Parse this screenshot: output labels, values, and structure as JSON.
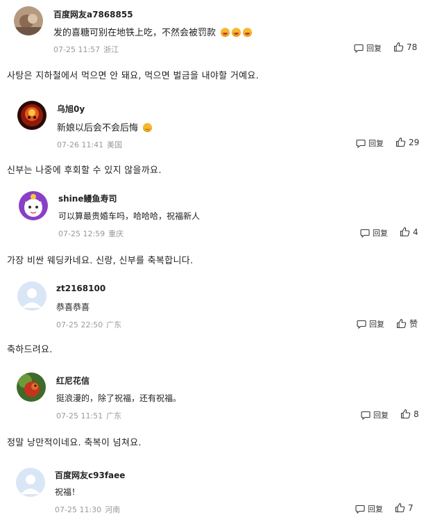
{
  "ui": {
    "reply_label": "回复",
    "comment_icon": "comment-icon",
    "like_icon": "thumbs-up-icon"
  },
  "comments": [
    {
      "username": "百度网友a7868855",
      "content": "发的喜糖可别在地铁上吃，不然会被罚款",
      "emoji": "grin",
      "date": "07-25 11:57",
      "location": "浙江",
      "likes": "78",
      "translation": "사탕은 지하철에서 먹으면 안 돼요, 먹으면 벌금을 내야할 거예요."
    },
    {
      "username": "乌旭0y",
      "content": "新娘以后会不会后悔",
      "emoji": "smile",
      "date": "07-26 11:41",
      "location": "美国",
      "likes": "29",
      "translation": "신부는 나중에 후회할 수 있지 않을까요."
    },
    {
      "username": "shine鳗鱼寿司",
      "content": "可以算最贵婚车吗，哈哈哈，祝福新人",
      "emoji": "",
      "date": "07-25 12:59",
      "location": "重庆",
      "likes": "4",
      "translation": "가장 비싼 웨딩카네요. 신랑, 신부를 축복합니다."
    },
    {
      "username": "zt2168100",
      "content": "恭喜恭喜",
      "emoji": "",
      "date": "07-25 22:50",
      "location": "广东",
      "likes": "赞",
      "translation": "축하드려요."
    },
    {
      "username": "红尼花信",
      "content": "挺浪漫的，除了祝福，还有祝福。",
      "emoji": "",
      "date": "07-25 11:51",
      "location": "广东",
      "likes": "8",
      "translation": "정말 낭만적이네요. 축복이 넘쳐요."
    },
    {
      "username": "百度网友c93faee",
      "content": "祝福！",
      "emoji": "",
      "date": "07-25 11:30",
      "location": "河南",
      "likes": "7",
      "translation": ""
    }
  ]
}
